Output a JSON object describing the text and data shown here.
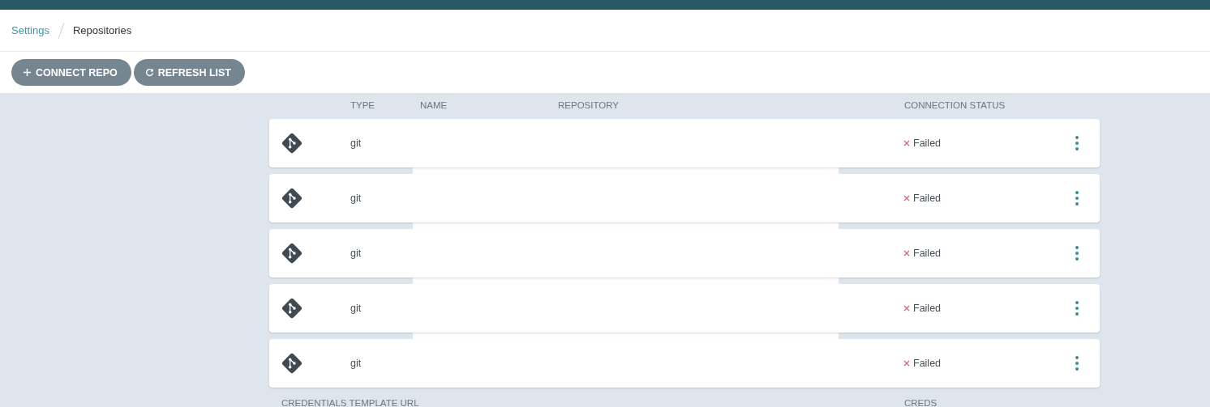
{
  "breadcrumb": [
    {
      "label": "Settings",
      "link": true
    },
    {
      "label": "Repositories",
      "link": false
    }
  ],
  "toolbar": [
    {
      "label": "CONNECT REPO",
      "kind": "add"
    },
    {
      "label": "REFRESH LIST",
      "kind": "refresh"
    }
  ],
  "table": {
    "columns": [
      "TYPE",
      "NAME",
      "REPOSITORY",
      "CONNECTION STATUS"
    ],
    "rows": [
      {
        "type": "git",
        "status": {
          "label": "Failed",
          "kind": "failed"
        }
      },
      {
        "type": "git",
        "status": {
          "label": "Failed",
          "kind": "failed"
        }
      },
      {
        "type": "git",
        "status": {
          "label": "Failed",
          "kind": "failed"
        }
      },
      {
        "type": "git",
        "status": {
          "label": "Failed",
          "kind": "failed"
        }
      },
      {
        "type": "git",
        "status": {
          "label": "Failed",
          "kind": "failed"
        }
      }
    ]
  },
  "credentials_table": {
    "columns": [
      "CREDENTIALS TEMPLATE URL",
      "CREDS"
    ]
  }
}
